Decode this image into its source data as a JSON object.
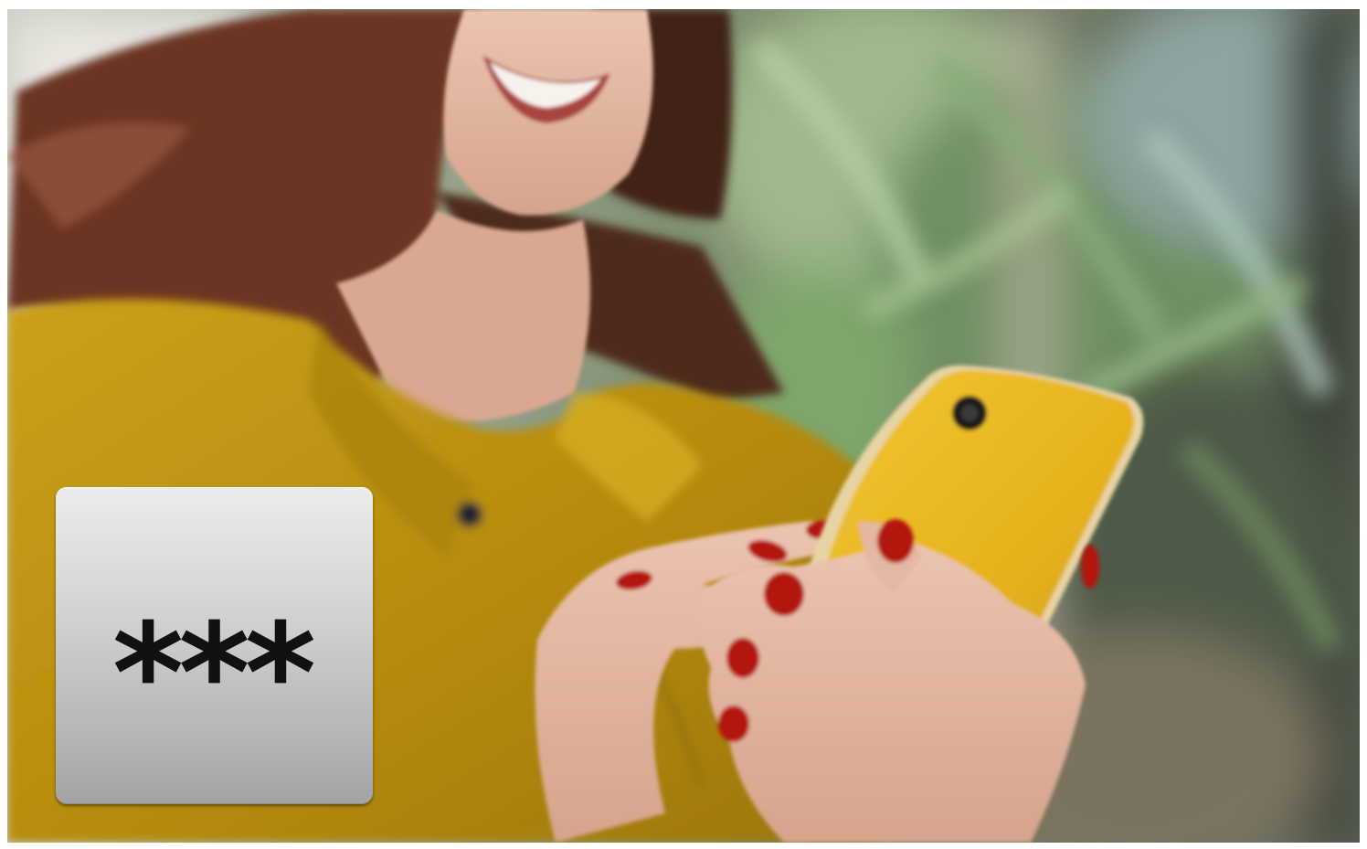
{
  "scene": {
    "palette": {
      "shirt": "#c29a12",
      "phone": "#eab923",
      "hair": "#5a2e1e",
      "skin": "#e3b49e",
      "nails": "#b3160f",
      "foliage": "#5f8a55"
    }
  },
  "overlay": {
    "mask_text": "***"
  }
}
